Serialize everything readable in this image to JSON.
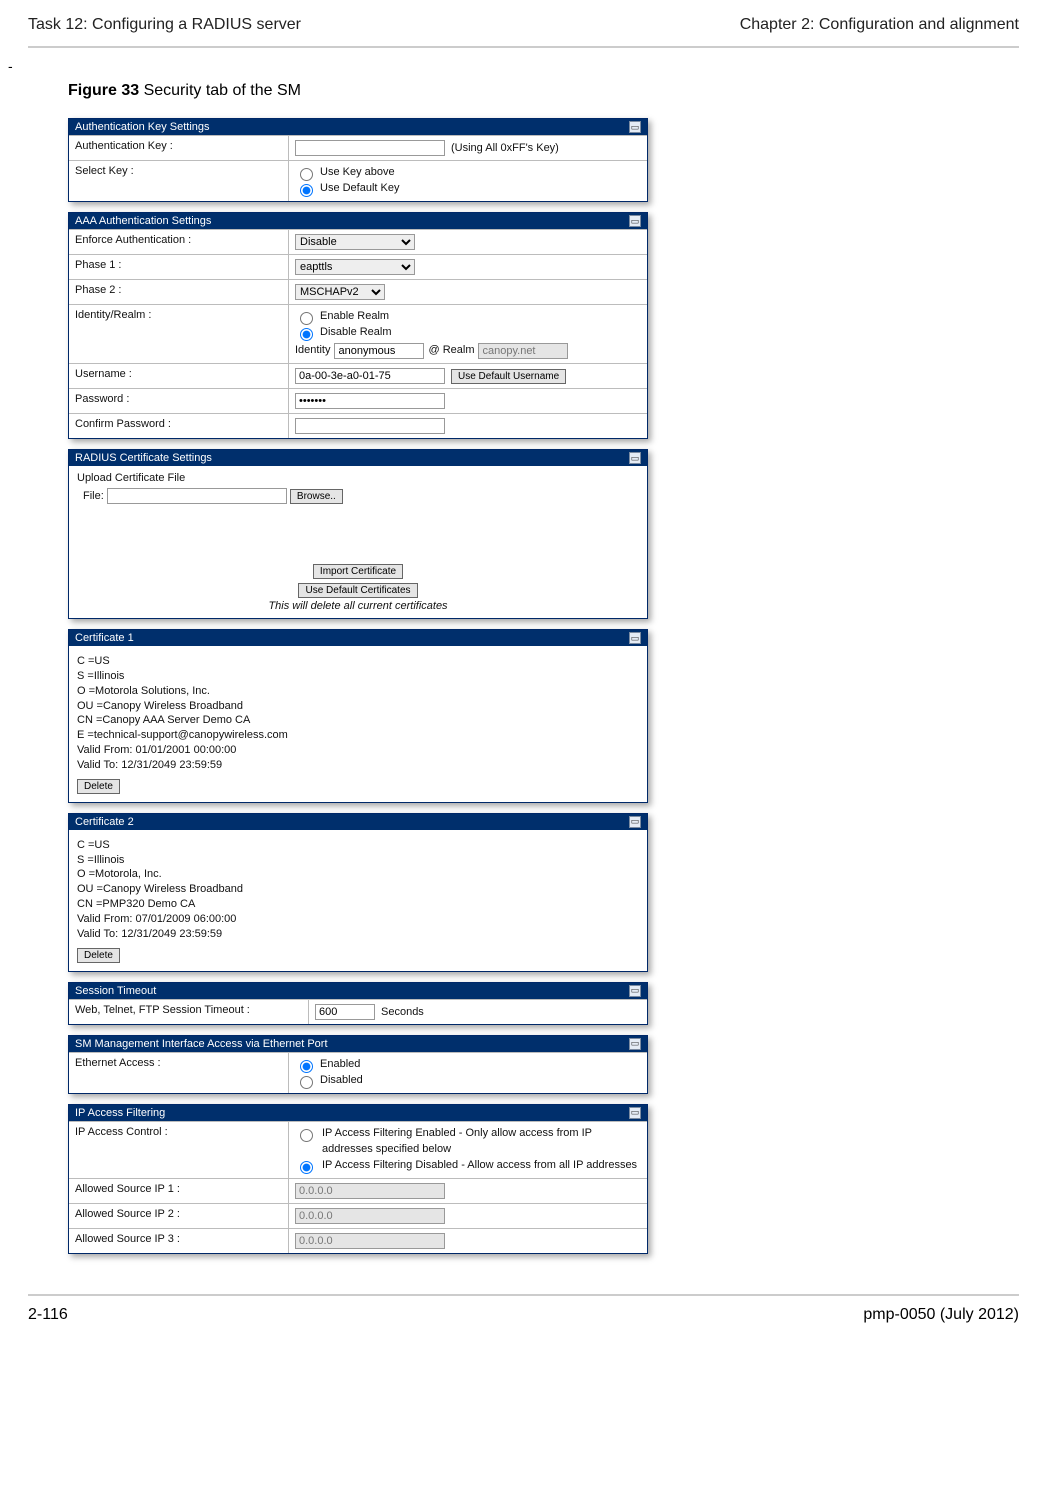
{
  "header": {
    "left": "Task 12: Configuring a RADIUS server",
    "right": "Chapter 2:  Configuration and alignment"
  },
  "dash": "-",
  "caption_bold": "Figure 33",
  "caption_rest": "  Security tab of the SM",
  "authKey": {
    "title": "Authentication Key Settings",
    "label_key": "Authentication Key :",
    "key_note": "(Using All 0xFF's Key)",
    "label_select": "Select Key :",
    "opt1": "Use Key above",
    "opt2": "Use Default Key"
  },
  "aaa": {
    "title": "AAA Authentication Settings",
    "l_enforce": "Enforce Authentication :",
    "v_enforce": "Disable",
    "l_phase1": "Phase 1 :",
    "v_phase1": "eapttls",
    "l_phase2": "Phase 2 :",
    "v_phase2": "MSCHAPv2",
    "l_realm": "Identity/Realm :",
    "realm_en": "Enable Realm",
    "realm_dis": "Disable Realm",
    "realm_id_lbl": "Identity",
    "realm_id_val": "anonymous",
    "realm_at": "@ Realm",
    "realm_val": "canopy.net",
    "l_user": "Username :",
    "v_user": "0a-00-3e-a0-01-75",
    "btn_user": "Use Default Username",
    "l_pass": "Password :",
    "v_pass": "●●●●●●●",
    "l_cpass": "Confirm Password :"
  },
  "radcert": {
    "title": "RADIUS Certificate Settings",
    "upload": "Upload Certificate File",
    "file_lbl": "File:",
    "browse": "Browse..",
    "import": "Import Certificate",
    "defaults": "Use Default Certificates",
    "warn": "This will delete all current certificates"
  },
  "cert1": {
    "title": "Certificate 1",
    "body": "C =US\nS =Illinois\nO =Motorola Solutions, Inc.\nOU =Canopy Wireless Broadband\nCN =Canopy AAA Server Demo CA\nE =technical-support@canopywireless.com\nValid From: 01/01/2001 00:00:00\nValid To: 12/31/2049 23:59:59",
    "delete": "Delete"
  },
  "cert2": {
    "title": "Certificate 2",
    "body": "C =US\nS =Illinois\nO =Motorola, Inc.\nOU =Canopy Wireless Broadband\nCN =PMP320 Demo CA\nValid From: 07/01/2009 06:00:00\nValid To: 12/31/2049 23:59:59",
    "delete": "Delete"
  },
  "session": {
    "title": "Session Timeout",
    "label": "Web, Telnet, FTP Session Timeout :",
    "value": "600",
    "unit": "Seconds"
  },
  "mgmt": {
    "title": "SM Management Interface Access via Ethernet Port",
    "label": "Ethernet Access :",
    "en": "Enabled",
    "dis": "Disabled"
  },
  "ipfilter": {
    "title": "IP Access Filtering",
    "l_ctrl": "IP Access Control :",
    "opt_en": "IP Access Filtering Enabled - Only allow access from IP addresses specified below",
    "opt_dis": "IP Access Filtering Disabled - Allow access from all IP addresses",
    "l1": "Allowed Source IP 1 :",
    "l2": "Allowed Source IP 2 :",
    "l3": "Allowed Source IP 3 :",
    "ph": "0.0.0.0"
  },
  "footer": {
    "left": "2-116",
    "right": "pmp-0050 (July 2012)"
  }
}
